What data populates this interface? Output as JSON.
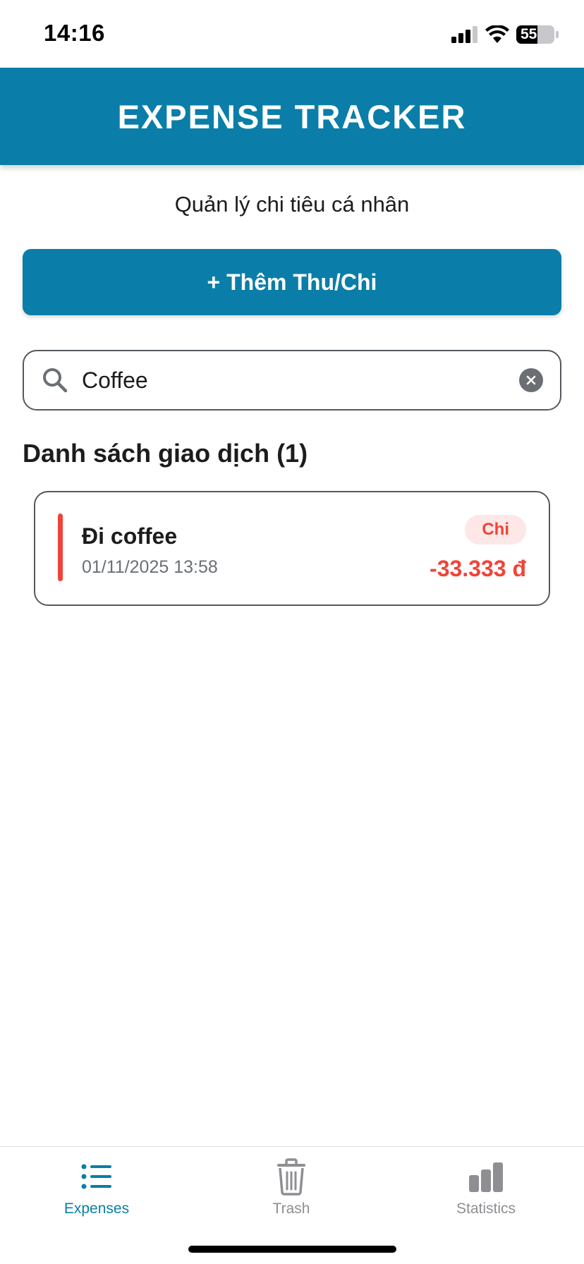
{
  "status_bar": {
    "time": "14:16",
    "battery": "55",
    "battery_level": 0.55
  },
  "header": {
    "title": "EXPENSE TRACKER"
  },
  "subtitle": "Quản lý chi tiêu cá nhân",
  "add_button": {
    "label": "+ Thêm Thu/Chi"
  },
  "search": {
    "value": "Coffee",
    "placeholder": ""
  },
  "list": {
    "title": "Danh sách giao dịch (1)",
    "items": [
      {
        "name": "Đi coffee",
        "datetime": "01/11/2025 13:58",
        "type": "Chi",
        "amount": "-33.333 đ"
      }
    ]
  },
  "tabs": [
    {
      "label": "Expenses",
      "icon": "list-icon",
      "active": true
    },
    {
      "label": "Trash",
      "icon": "trash-icon",
      "active": false
    },
    {
      "label": "Statistics",
      "icon": "bar-chart-icon",
      "active": false
    }
  ],
  "colors": {
    "primary": "#0a7ea8",
    "expense_red": "#f04438",
    "badge_bg": "#fde7e7",
    "inactive_gray": "#8e8e93"
  }
}
